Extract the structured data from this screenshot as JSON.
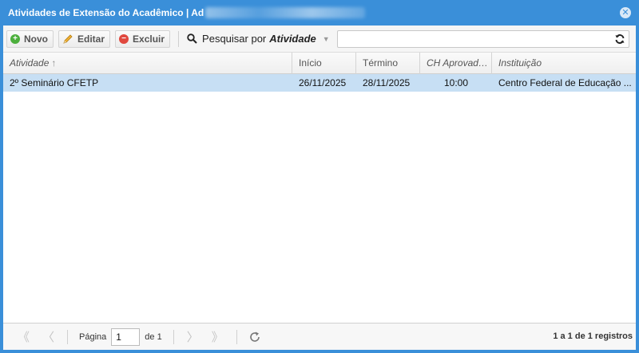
{
  "window": {
    "title": "Atividades de Extensão do Acadêmico | Ad",
    "close_symbol": "✕"
  },
  "toolbar": {
    "new_label": "Novo",
    "edit_label": "Editar",
    "delete_label": "Excluir",
    "search_by_prefix": "Pesquisar por",
    "search_by_field": "Atividade",
    "search_value": "",
    "icons": {
      "new": "add-icon",
      "edit": "pencil-icon",
      "delete": "remove-icon",
      "search": "magnifier-icon",
      "refresh": "refresh-icon"
    }
  },
  "grid": {
    "columns": [
      "Atividade",
      "Início",
      "Término",
      "CH Aprovada...",
      "Instituição"
    ],
    "sort_indicator": "↑",
    "rows": [
      [
        "2º Seminário CFETP",
        "26/11/2025",
        "28/11/2025",
        "10:00",
        "Centro Federal de Educação ..."
      ]
    ],
    "selected_row_color": "#c7dff4"
  },
  "pager": {
    "page_label": "Página",
    "page_value": "1",
    "of_label": "de 1",
    "info": "1 a 1 de 1 registros"
  },
  "colors": {
    "accent": "#3a8fd9"
  }
}
